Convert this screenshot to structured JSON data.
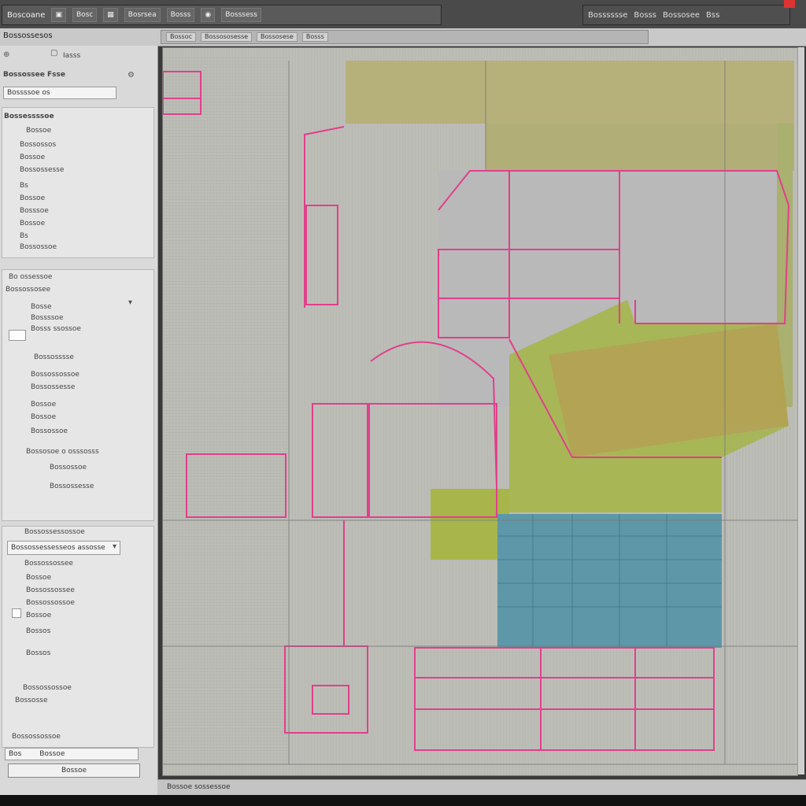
{
  "app": {
    "title": "Boscoane",
    "menu": [
      "Bosc",
      "Bosrsea",
      "Bosss",
      "Bosssess"
    ],
    "right_menu": [
      "Bosssssse",
      "Bosss",
      "Bossosee",
      "Bss"
    ]
  },
  "subbar": {
    "title": "Bossossesos",
    "tabs": [
      "Bossoc",
      "Bossososesse",
      "Bossosese",
      "Bosss"
    ]
  },
  "left_panel": {
    "header": "Iasss",
    "prop_title": "Bossossee Fsse",
    "file_field": "Bossssoe os",
    "section1_title": "Bossessssoe",
    "section1_items": [
      "Bossoe",
      "Bossossos",
      "Bossoe",
      "Bossossesse",
      "Bs",
      "Bossoe",
      "Bosssoe",
      "Bossoe",
      "Bs",
      "Bossossoe"
    ],
    "section2_title": "Bo ossessoe",
    "section2_sub": "Bossossosee",
    "section2_items": [
      "Bosse",
      "Bossssoe",
      "Bosss ssossoe",
      "Bossosssse",
      "Bossossossoe",
      "Bossossesse",
      "Bossoe",
      "Bossoe",
      "Bossossoe",
      "Bossosoe o osssosss",
      "Bossossoe",
      "Bossossesse"
    ],
    "section3_title": "Bossossessossoe",
    "dropdown_value": "Bossossessesseos assosse",
    "section3_sub": "Bossossossee",
    "section3_items": [
      "Bossoe",
      "Bossossossee",
      "Bossossossoe",
      "Bossoe",
      "Bossos",
      "Bossos",
      "Bossossossoe",
      "Bossosse",
      "Bossossossoe"
    ],
    "bottom_field_label": "Bos",
    "bottom_field_value": "Bossoe",
    "bottom_button": "Bossoe"
  },
  "status": {
    "text": "Bossoe sossessoe"
  }
}
